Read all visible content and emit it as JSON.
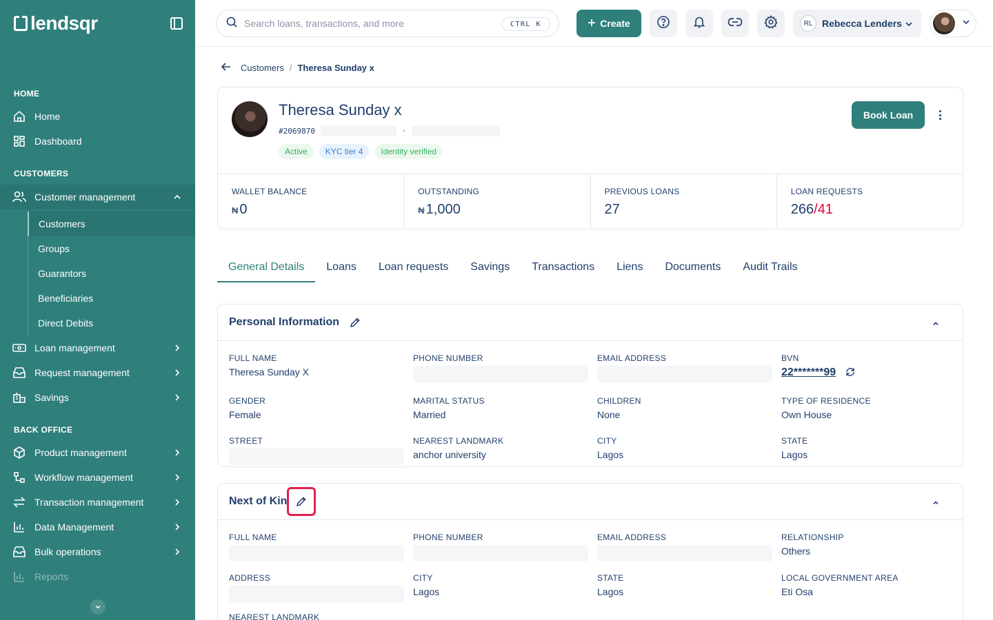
{
  "sidebar": {
    "brand": "lendsqr",
    "sections": {
      "home": "HOME",
      "customers": "CUSTOMERS",
      "back_office": "BACK OFFICE"
    },
    "items": {
      "home": "Home",
      "dashboard": "Dashboard",
      "customer_management": "Customer management",
      "customers": "Customers",
      "groups": "Groups",
      "guarantors": "Guarantors",
      "beneficiaries": "Beneficiaries",
      "direct_debits": "Direct Debits",
      "loan_management": "Loan management",
      "request_management": "Request management",
      "savings": "Savings",
      "product_management": "Product management",
      "workflow_management": "Workflow management",
      "transaction_management": "Transaction management",
      "data_management": "Data Management",
      "bulk_operations": "Bulk operations",
      "reports": "Reports"
    }
  },
  "topbar": {
    "search_placeholder": "Search loans, transactions, and more",
    "shortcut": "CTRL K",
    "create_label": "Create",
    "org_initials": "RL",
    "org_name": "Rebecca Lenders"
  },
  "breadcrumb": {
    "parent": "Customers",
    "current": "Theresa Sunday x"
  },
  "profile": {
    "name": "Theresa Sunday x",
    "id": "#2069870",
    "tags": [
      "Active",
      "KYC tier 4",
      "Identity verified"
    ],
    "book_loan_label": "Book Loan"
  },
  "stats": {
    "wallet_label": "WALLET BALANCE",
    "wallet_currency": "₦",
    "wallet_value": "0",
    "outstanding_label": "OUTSTANDING",
    "outstanding_currency": "₦",
    "outstanding_value": "1,000",
    "prev_loans_label": "PREVIOUS LOANS",
    "prev_loans_value": "27",
    "requests_label": "LOAN REQUESTS",
    "requests_total": "266",
    "requests_sep": "/",
    "requests_highlight": "41"
  },
  "tabs": [
    "General Details",
    "Loans",
    "Loan requests",
    "Savings",
    "Transactions",
    "Liens",
    "Documents",
    "Audit Trails"
  ],
  "personal": {
    "title": "Personal Information",
    "full_name_label": "FULL NAME",
    "full_name": "Theresa Sunday X",
    "phone_label": "PHONE NUMBER",
    "email_label": "EMAIL ADDRESS",
    "bvn_label": "BVN",
    "bvn": "22*******99",
    "gender_label": "GENDER",
    "gender": "Female",
    "marital_label": "MARITAL STATUS",
    "marital": "Married",
    "children_label": "CHILDREN",
    "children": "None",
    "residence_label": "TYPE OF RESIDENCE",
    "residence": "Own House",
    "street_label": "STREET",
    "landmark_label": "NEAREST LANDMARK",
    "landmark": "anchor university",
    "city_label": "CITY",
    "city": "Lagos",
    "state_label": "STATE",
    "state": "Lagos"
  },
  "kin": {
    "title": "Next of Kin",
    "full_name_label": "FULL NAME",
    "phone_label": "PHONE NUMBER",
    "email_label": "EMAIL ADDRESS",
    "relationship_label": "RELATIONSHIP",
    "relationship": "Others",
    "address_label": "ADDRESS",
    "city_label": "CITY",
    "city": "Lagos",
    "state_label": "STATE",
    "state": "Lagos",
    "lga_label": "LOCAL GOVERNMENT AREA",
    "lga": "Eti Osa",
    "landmark_label": "NEAREST LANDMARK"
  },
  "colors": {
    "brand": "#2f7f7b",
    "text": "#213f6b",
    "highlight_red": "#e4033b",
    "tag_green": "#35b25a",
    "tag_blue": "#3a7fd6"
  }
}
